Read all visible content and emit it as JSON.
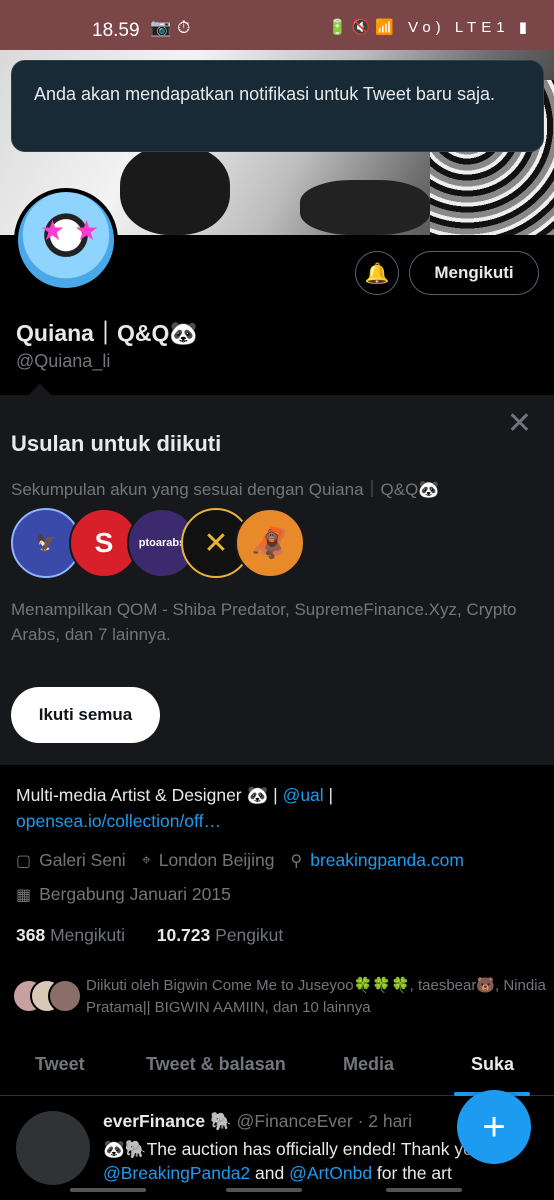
{
  "status_bar": {
    "time": "18.59",
    "left_icons": "📷⏱",
    "right_icons": "🔋🔇📶 Vo) LTE1 ▮"
  },
  "toast": {
    "text": "Anda akan mendapatkan notifikasi untuk Tweet baru saja."
  },
  "profile": {
    "display_name": "Quiana｜Q&Q🐼",
    "handle": "@Quiana_li",
    "bell_icon": "🔔",
    "follow_button_label": "Mengikuti"
  },
  "suggestions": {
    "close_icon": "✕",
    "title": "Usulan untuk diikuti",
    "subtitle": "Sekumpulan akun yang sesuai dengan Quiana｜Q&Q🐼",
    "avatars": [
      {
        "text": "🦅",
        "color": "#3a4aa8"
      },
      {
        "text": "S",
        "color": "#d8202a"
      },
      {
        "text": "ptoarabs",
        "color": "#3b2b6e"
      },
      {
        "text": "✕",
        "color": "#111111"
      },
      {
        "text": "🦧",
        "color": "#e8892a"
      }
    ],
    "description": "Menampilkan QOM - Shiba Predator, SupremeFinance.Xyz, Crypto Arabs, dan 7 lainnya.",
    "follow_all_label": "Ikuti semua"
  },
  "bio": {
    "text": "Multi-media Artist & Designer 🐼 | ",
    "mention": "@ual",
    "separator": " | ",
    "url": "opensea.io/collection/off…"
  },
  "meta": {
    "category": "Galeri Seni",
    "location": "London Beijing",
    "website": "breakingpanda.com",
    "joined": "Bergabung Januari 2015"
  },
  "stats": {
    "following_count": "368",
    "following_label": "Mengikuti",
    "followers_count": "10.723",
    "followers_label": "Pengikut"
  },
  "followed_by": {
    "text": "Diikuti oleh Bigwin Come Me to Juseyoo🍀🍀🍀, taesbear🐻, Nindia Pratama|| BIGWIN AAMIIN, dan 10 lainnya"
  },
  "tabs": [
    "Tweet",
    "Tweet & balasan",
    "Media",
    "Suka"
  ],
  "tweet": {
    "name": "everFinance 🐘",
    "handle": "@FinanceEver",
    "time": "· 2 hari",
    "body_line1": "🐼🐘The auction has officially ended! Thank you to",
    "mention1": "@BreakingPanda2",
    "and": " and ",
    "mention2": "@ArtOnbd",
    "tail": " for the art"
  },
  "fab_icon": "+"
}
